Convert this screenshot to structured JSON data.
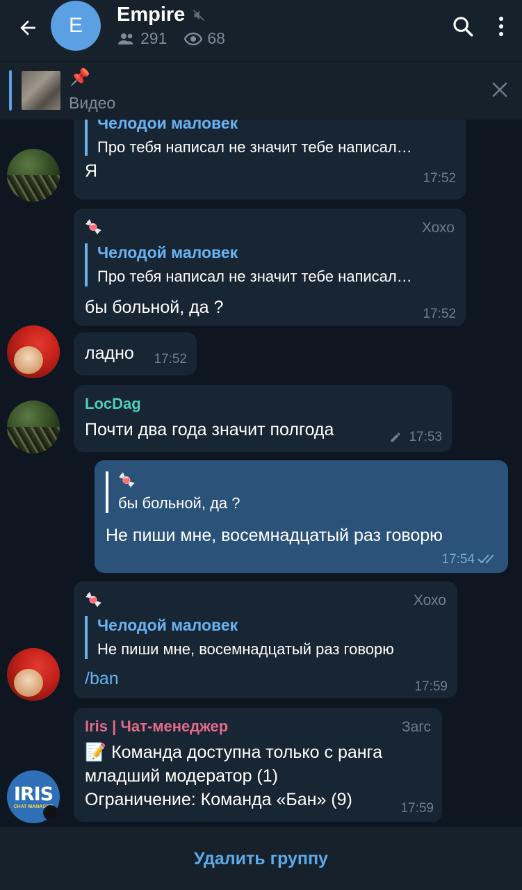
{
  "header": {
    "avatar_letter": "E",
    "title": "Empire",
    "members": "291",
    "viewers": "68"
  },
  "pinned": {
    "label": "Видео"
  },
  "messages": [
    {
      "quote_name": "Челодой маловек",
      "quote_text": "Про тебя написал не значит тебе написал…",
      "text": "Я",
      "time": "17:52"
    },
    {
      "sender_emoji": "🍬",
      "badge": "Хохо",
      "quote_name": "Челодой маловек",
      "quote_text": "Про тебя написал не значит тебе написал…",
      "text": "бы больной, да ?",
      "time": "17:52"
    },
    {
      "text": "ладно",
      "time": "17:52"
    },
    {
      "sender": "LocDag",
      "text": "Почти два года значит полгода",
      "time": "17:53"
    },
    {
      "quote_name": "🍬",
      "quote_text": "бы больной, да ?",
      "text": "Не пиши мне, восемнадцатый раз говорю",
      "time": "17:54"
    },
    {
      "sender_emoji": "🍬",
      "badge": "Хохо",
      "quote_name": "Челодой маловек",
      "quote_text": "Не пиши мне, восемнадцатый раз говорю",
      "text": "/ban",
      "time": "17:59"
    },
    {
      "sender": "Iris | Чат-менеджер",
      "badge": "Загс",
      "line1": "📝 Команда доступна только с ранга",
      "line2": "младший модератор (1)",
      "line3": "Ограничение: Команда «Бан» (9)",
      "time": "17:59"
    }
  ],
  "iris_avatar": {
    "big": "IRIS",
    "small": "CHAT MANAGER"
  },
  "bottom": {
    "action": "Удалить группу"
  },
  "colors": {
    "accent": "#5aa0e3",
    "bubble_in": "#182533",
    "bubble_out": "#2b5278",
    "bg": "#0e1621",
    "locdag": "#4fcdb9",
    "iris": "#e5698b"
  }
}
